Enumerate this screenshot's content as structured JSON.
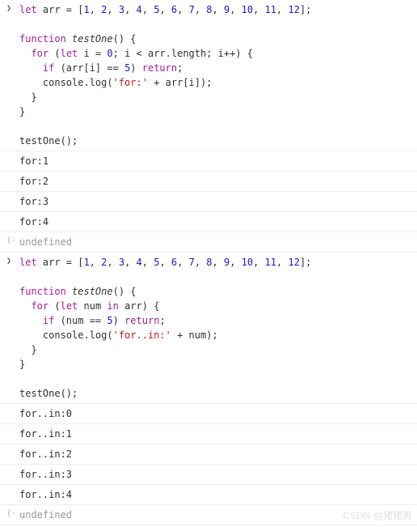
{
  "block1": {
    "code": {
      "l1_kw1": "let",
      "l1_t1": " arr = [",
      "l1_n": [
        "1",
        "2",
        "3",
        "4",
        "5",
        "6",
        "7",
        "8",
        "9",
        "10",
        "11",
        "12"
      ],
      "l1_t2": "];",
      "l3_kw1": "function",
      "l3_t1": " ",
      "l3_fn": "testOne",
      "l3_t2": "() {",
      "l4_kw1": "for",
      "l4_t1": " (",
      "l4_kw2": "let",
      "l4_t2": " i = ",
      "l4_n1": "0",
      "l4_t3": "; i < arr.length; i++) {",
      "l5_kw1": "if",
      "l5_t1": " (arr[i] == ",
      "l5_n1": "5",
      "l5_t2": ") ",
      "l5_kw2": "return",
      "l5_t3": ";",
      "l6_t1": "console.log(",
      "l6_s1": "'for:'",
      "l6_t2": " + arr[i]);",
      "l7": "  }",
      "l8": "}",
      "l10": "testOne();"
    },
    "outputs": [
      "for:1",
      "for:2",
      "for:3",
      "for:4"
    ],
    "result": "undefined"
  },
  "block2": {
    "code": {
      "l1_kw1": "let",
      "l1_t1": " arr = [",
      "l1_n": [
        "1",
        "2",
        "3",
        "4",
        "5",
        "6",
        "7",
        "8",
        "9",
        "10",
        "11",
        "12"
      ],
      "l1_t2": "];",
      "l3_kw1": "function",
      "l3_t1": " ",
      "l3_fn": "testOne",
      "l3_t2": "() {",
      "l4_kw1": "for",
      "l4_t1": " (",
      "l4_kw2": "let",
      "l4_t2": " num ",
      "l4_kw3": "in",
      "l4_t3": " arr) {",
      "l5_kw1": "if",
      "l5_t1": " (num == ",
      "l5_n1": "5",
      "l5_t2": ") ",
      "l5_kw2": "return",
      "l5_t3": ";",
      "l6_t1": "console.log(",
      "l6_s1": "'for..in:'",
      "l6_t2": " + num);",
      "l7": "  }",
      "l8": "}",
      "l10": "testOne();"
    },
    "outputs": [
      "for..in:0",
      "for..in:1",
      "for..in:2",
      "for..in:3",
      "for..in:4"
    ],
    "result": "undefined"
  },
  "watermark": "CSDN @猪猪男"
}
